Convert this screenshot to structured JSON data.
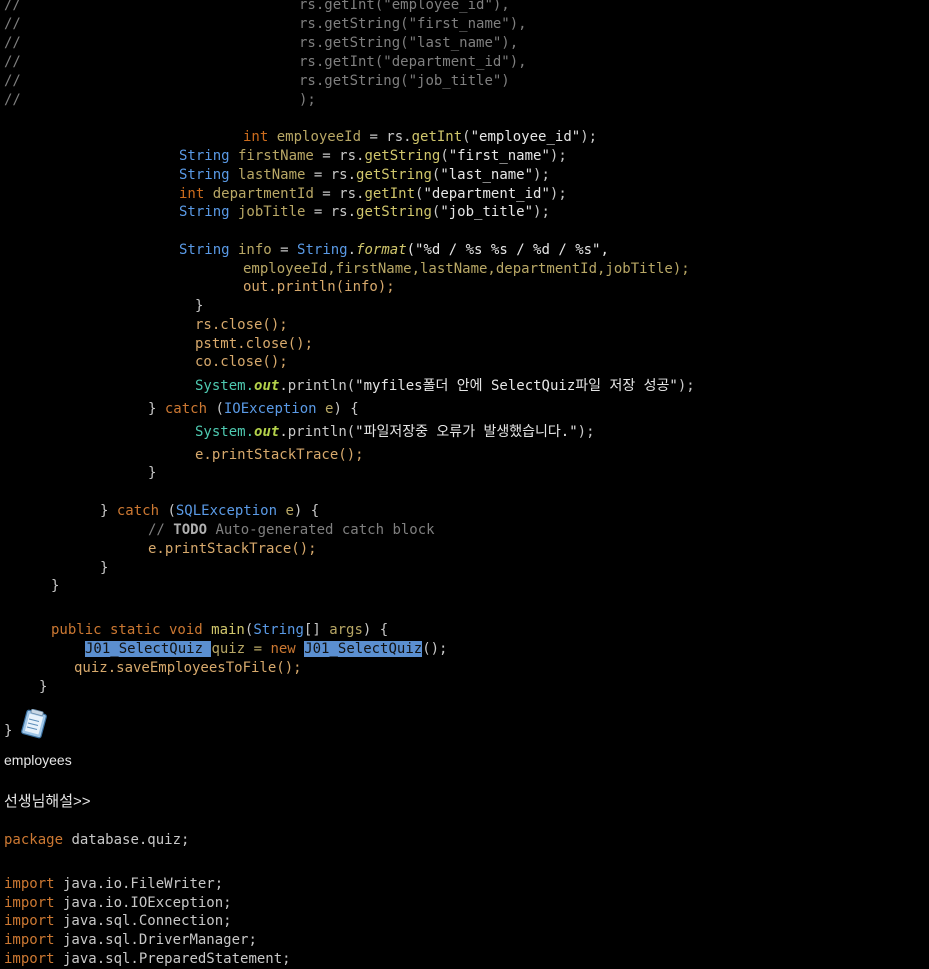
{
  "code_top": {
    "lines": [
      {
        "c": "//",
        "rest": "                                 rs.getInt(\"employee_id\"),"
      },
      {
        "c": "//",
        "rest": "                                 rs.getString(\"first_name\"),"
      },
      {
        "c": "//",
        "rest": "                                 rs.getString(\"last_name\"),"
      },
      {
        "c": "//",
        "rest": "                                 rs.getInt(\"department_id\"),"
      },
      {
        "c": "//",
        "rest": "                                 rs.getString(\"job_title\")"
      },
      {
        "c": "//",
        "rest": "                                 );"
      }
    ]
  },
  "code": {
    "l1_type": "int",
    "l1_var": " employeeId",
    "l1_mid": " = rs.",
    "l1_fn": "getInt",
    "l1_str": "\"employee_id\"",
    "l1_end": ");",
    "l2_type": "String",
    "l2_var": " firstName",
    "l2_mid": " = rs.",
    "l2_fn": "getString",
    "l2_str": "\"first_name\"",
    "l2_end": ");",
    "l3_type": "String",
    "l3_var": " lastName",
    "l3_mid": " = rs.",
    "l3_fn": "getString",
    "l3_str": "\"last_name\"",
    "l3_end": ");",
    "l4_type": "int",
    "l4_var": " departmentId",
    "l4_mid": " = rs.",
    "l4_fn": "getInt",
    "l4_str": "\"department_id\"",
    "l4_end": ");",
    "l5_type": "String",
    "l5_var": " jobTitle",
    "l5_mid": " = rs.",
    "l5_fn": "getString",
    "l5_str": "\"job_title\"",
    "l5_end": ");",
    "l6_type": "String",
    "l6_var": " info",
    "l6_mid": " = ",
    "l6_type2": "String",
    "l6_dot": ".",
    "l6_fn": "format",
    "l6_str": "(\"%d / %s %s / %d / %s\",",
    "l7": "employeeId,firstName,lastName,departmentId,jobTitle);",
    "l8": "out.println(info);",
    "l9": "}",
    "l10": "rs.close();",
    "l11": "pstmt.close();",
    "l12": "co.close();",
    "l13_sys": "System.",
    "l13_out": "out",
    "l13_rest": ".println(",
    "l13_str": "\"myfiles폴더 안에 SelectQuiz파일 저장 성공\"",
    "l13_end": ");",
    "l14_a": "} ",
    "l14_kw": "catch",
    "l14_b": " (",
    "l14_type": "IOException",
    "l14_var": " e",
    "l14_c": ") {",
    "l15_sys": "System.",
    "l15_out": "out",
    "l15_rest": ".println(",
    "l15_str": "\"파일저장중 오류가 발생했습니다.\"",
    "l15_end": ");",
    "l16": "e.printStackTrace();",
    "l17": "}",
    "l18_a": "} ",
    "l18_kw": "catch",
    "l18_b": " (",
    "l18_type": "SQLException",
    "l18_var": " e",
    "l18_c": ") {",
    "l19_com": "// ",
    "l19_todo": "TODO",
    "l19_rest": " Auto-generated catch block",
    "l20": "e.printStackTrace();",
    "l21": "}",
    "l22": "}",
    "l23_kw": "public static void",
    "l23_fn": " main",
    "l23_a": "(",
    "l23_type": "String",
    "l23_b": "[] ",
    "l23_var": "args",
    "l23_c": ") {",
    "l24_hl1": "J01_SelectQuiz ",
    "l24_mid": "quiz = ",
    "l24_kw": "new",
    "l24_sp": " ",
    "l24_hl2": "J01_SelectQuiz",
    "l24_end": "();",
    "l25": "quiz.saveEmployeesToFile();",
    "l26": "}",
    "l27": "}"
  },
  "caption": "employees",
  "section_title": "선생님해설>>",
  "code_bottom": {
    "pkg_kw": "package",
    "pkg_rest": " database.quiz;",
    "imports": [
      {
        "kw": "import",
        "rest": " java.io.FileWriter;"
      },
      {
        "kw": "import",
        "rest": " java.io.IOException;"
      },
      {
        "kw": "import",
        "rest": " java.sql.Connection;"
      },
      {
        "kw": "import",
        "rest": " java.sql.DriverManager;"
      },
      {
        "kw": "import",
        "rest": " java.sql.PreparedStatement;"
      }
    ]
  },
  "icons": {
    "note": "notepad-icon"
  },
  "colors": {
    "background": "#000000",
    "keyword": "#cc7832",
    "type": "#5a9ae6",
    "highlight": "#5b8fd0"
  }
}
